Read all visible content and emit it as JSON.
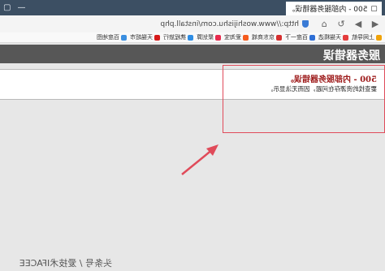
{
  "browser": {
    "tab_title": "500 - 内部服务器错误。",
    "address": "http://www.woshijishu.com/install.php",
    "bookmarks": [
      {
        "icon": "star-icon",
        "label": "上网导航",
        "color": "#f0a30a"
      },
      {
        "icon": "bookmark-icon",
        "label": "天猫精选",
        "color": "#e43d3d"
      },
      {
        "icon": "bookmark-icon",
        "label": "百度一下",
        "color": "#2f6fd6"
      },
      {
        "icon": "bookmark-icon",
        "label": "京东商城",
        "color": "#d62f2f"
      },
      {
        "icon": "bookmark-icon",
        "label": "爱淘宝",
        "color": "#f55c1e"
      },
      {
        "icon": "bookmark-icon",
        "label": "聚划算",
        "color": "#e82a4d"
      },
      {
        "icon": "bookmark-icon",
        "label": "携程旅行",
        "color": "#2e8de4"
      },
      {
        "icon": "bookmark-icon",
        "label": "天猫超市",
        "color": "#d61a1a"
      },
      {
        "icon": "bookmark-icon",
        "label": "百度地图",
        "color": "#3b8fe0"
      }
    ]
  },
  "page": {
    "header_title": "服务器错误",
    "error_title": "500 - 内部服务器错误。",
    "error_desc": "要查找的资源存在问题，因而无法显示。"
  },
  "watermark": "头条号 / 爱技术IFACEE",
  "colors": {
    "tab_bar": "#3c4f63",
    "header_bar": "#575757",
    "error_red": "#9d1a1a",
    "highlight_red": "#e04b5a"
  }
}
